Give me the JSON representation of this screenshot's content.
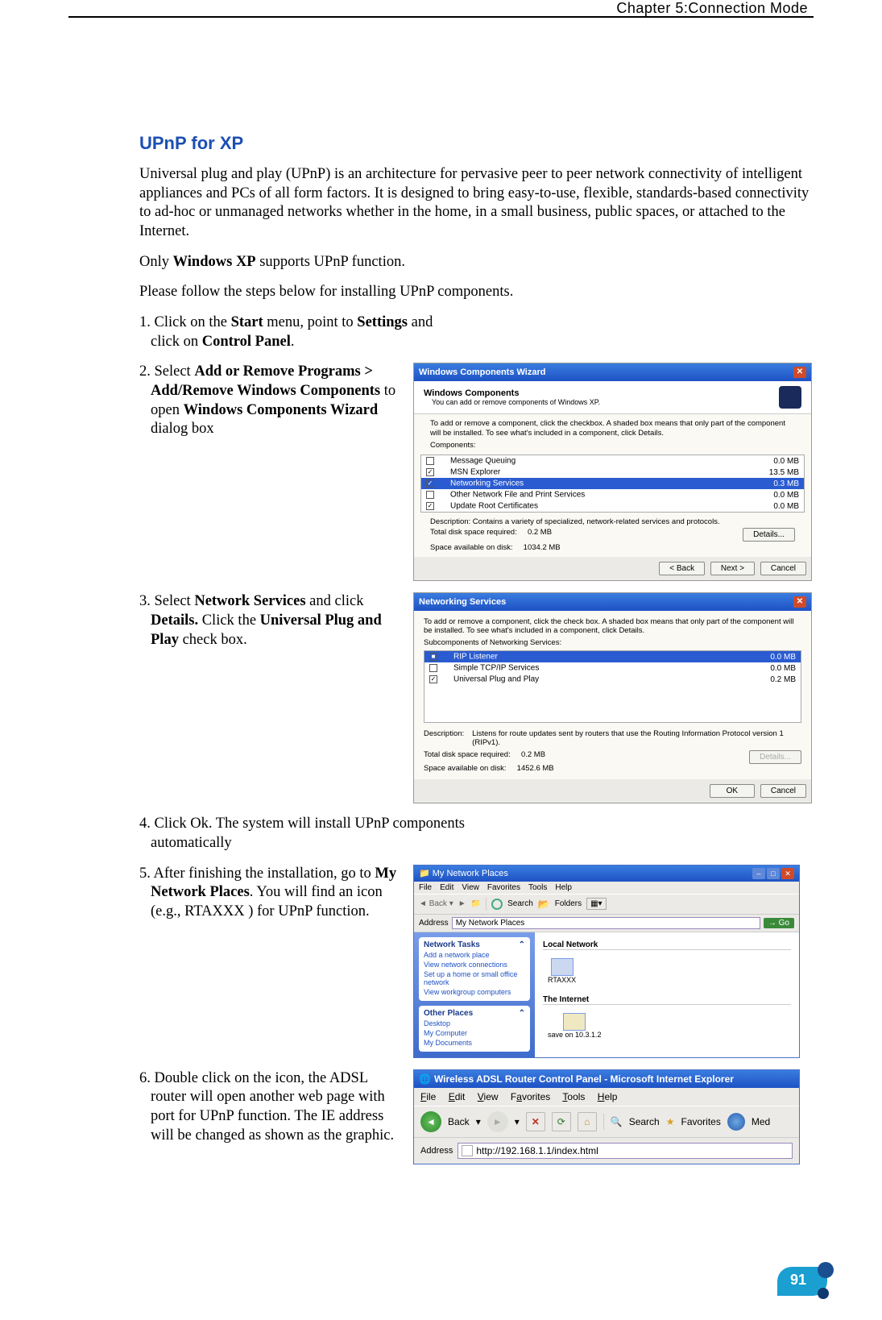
{
  "header": {
    "chapter": "Chapter 5:Connection Mode"
  },
  "title": "UPnP for XP",
  "intro": "Universal plug and play (UPnP) is an architecture for pervasive peer to peer network connectivity of intelligent appliances and PCs of all form factors. It is designed to bring easy-to-use, flexible, standards-based connectivity to ad-hoc or unmanaged networks whether in the home, in a small business, public spaces, or attached to the Internet.",
  "supports_pre": "Only ",
  "supports_b": "Windows XP",
  "supports_post": " supports UPnP function.",
  "follow": "Please follow the steps below for installing UPnP components.",
  "step1": {
    "pre": "1. Click on the ",
    "b1": "Start",
    "mid1": " menu, point to ",
    "b2": "Settings",
    "mid2": " and click on ",
    "b3": "Control Panel",
    "post": "."
  },
  "step2": {
    "pre": "2. Select ",
    "b1": "Add or Remove Programs > Add/Remove Windows Components",
    "mid1": " to open ",
    "b2": "Windows Components Wizard",
    "post": " dialog box"
  },
  "wcw": {
    "title": "Windows Components Wizard",
    "h1": "Windows Components",
    "h2": "You can add or remove components of Windows XP.",
    "instr": "To add or remove a component, click the checkbox. A shaded box means that only part of the component will be installed. To see what's included in a component, click Details.",
    "comp_label": "Components:",
    "rows": [
      {
        "chk": "",
        "name": "Message Queuing",
        "size": "0.0 MB"
      },
      {
        "chk": "✓",
        "name": "MSN Explorer",
        "size": "13.5 MB"
      },
      {
        "chk": "✓",
        "name": "Networking Services",
        "size": "0.3 MB",
        "sel": true
      },
      {
        "chk": "",
        "name": "Other Network File and Print Services",
        "size": "0.0 MB"
      },
      {
        "chk": "✓",
        "name": "Update Root Certificates",
        "size": "0.0 MB"
      }
    ],
    "desc": "Description:   Contains a variety of specialized, network-related services and protocols.",
    "tdsr": "Total disk space required:",
    "tdsr_v": "0.2 MB",
    "savd": "Space available on disk:",
    "savd_v": "1034.2 MB",
    "details_btn": "Details...",
    "back_btn": "< Back",
    "next_btn": "Next >",
    "cancel_btn": "Cancel"
  },
  "step3": {
    "pre": "3. Select ",
    "b1": "Network Services",
    "mid1": " and click ",
    "b2": "Details.",
    "mid2": " Click the ",
    "b3": "Universal Plug and Play",
    "post": " check box."
  },
  "ns": {
    "title": "Networking Services",
    "instr": "To add or remove a component, click the check box. A shaded box means that only part of the component will be installed. To see what's included in a component, click Details.",
    "sub_label": "Subcomponents of Networking Services:",
    "rows": [
      {
        "chk": "■",
        "name": "RIP Listener",
        "size": "0.0 MB",
        "sel": true
      },
      {
        "chk": "",
        "name": "Simple TCP/IP Services",
        "size": "0.0 MB"
      },
      {
        "chk": "✓",
        "name": "Universal Plug and Play",
        "size": "0.2 MB"
      }
    ],
    "desc_l": "Description:",
    "desc": "Listens for route updates sent by routers that use the Routing Information Protocol version 1 (RIPv1).",
    "tdsr": "Total disk space required:",
    "tdsr_v": "0.2 MB",
    "savd": "Space available on disk:",
    "savd_v": "1452.6 MB",
    "details_btn": "Details...",
    "ok_btn": "OK",
    "cancel_btn": "Cancel"
  },
  "step4": "4. Click Ok. The system will install UPnP components automatically",
  "step5": {
    "pre": "5. After finishing the installation, go to ",
    "b1": "My Network Places",
    "post": ". You will find an icon (e.g., RTAXXX ) for UPnP function."
  },
  "mnp": {
    "title": "My Network Places",
    "menu": [
      "File",
      "Edit",
      "View",
      "Favorites",
      "Tools",
      "Help"
    ],
    "addr_label": "Address",
    "addr_value": "My Network Places",
    "go": "Go",
    "tb_back": "Back",
    "tb_search": "Search",
    "tb_folders": "Folders",
    "panels": {
      "tasks_h": "Network Tasks",
      "tasks": [
        "Add a network place",
        "View network connections",
        "Set up a home or small office network",
        "View workgroup computers"
      ],
      "other_h": "Other Places",
      "other": [
        "Desktop",
        "My Computer",
        "My Documents"
      ]
    },
    "groups": {
      "local": "Local Network",
      "local_item": "RTAXXX",
      "internet": "The Internet",
      "internet_item": "save on 10.3.1.2"
    }
  },
  "step6": "6. Double click on the icon, the ADSL router will open another web page with port for UPnP function. The IE address will be changed as shown as the graphic.",
  "ie": {
    "title": "Wireless ADSL Router Control Panel - Microsoft Internet Explorer",
    "menu": {
      "file": "File",
      "edit": "Edit",
      "view": "View",
      "fav": "Favorites",
      "tools": "Tools",
      "help": "Help"
    },
    "back": "Back",
    "search": "Search",
    "favorites": "Favorites",
    "media": "Med",
    "addr_label": "Address",
    "addr_value": "http://192.168.1.1/index.html"
  },
  "page_number": "91"
}
